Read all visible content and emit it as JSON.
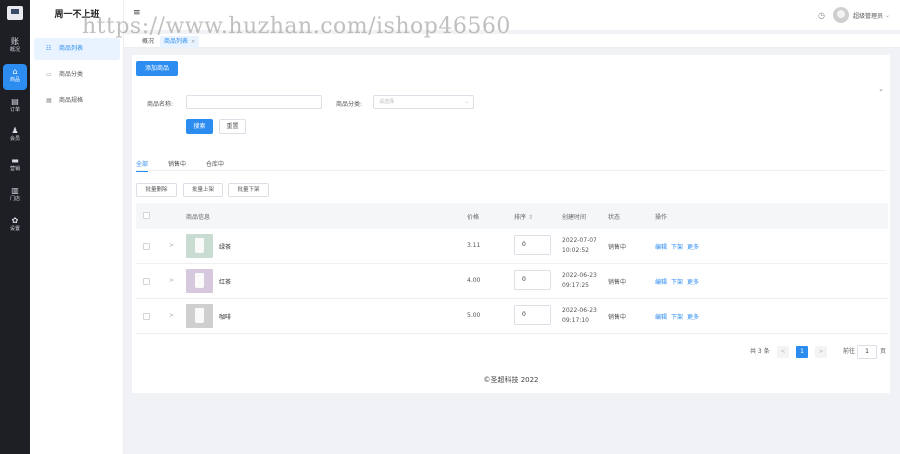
{
  "app": {
    "brand": "周一不上班"
  },
  "rail": [
    {
      "icon": "账",
      "label": "概况"
    },
    {
      "icon": "⌂",
      "label": "商品"
    },
    {
      "icon": "▤",
      "label": "订单"
    },
    {
      "icon": "♟",
      "label": "会员"
    },
    {
      "icon": "▬",
      "label": "营销"
    },
    {
      "icon": "▥",
      "label": "门店"
    },
    {
      "icon": "✿",
      "label": "设置"
    }
  ],
  "submenu": [
    {
      "label": "商品列表"
    },
    {
      "label": "商品分类"
    },
    {
      "label": "商品规格"
    }
  ],
  "header": {
    "menu_icon": "≡",
    "bell_icon": "◷",
    "user_name": "超级管理员",
    "chevron": "⌄"
  },
  "tabs": [
    {
      "label": "概况"
    },
    {
      "label": "商品列表",
      "close": "×"
    }
  ],
  "toolbar": {
    "add_label": "添加商品",
    "collapse_icon": "⌄"
  },
  "filters": {
    "name_label": "商品名称:",
    "name_value": "",
    "category_label": "商品分类:",
    "category_placeholder": "请选择",
    "category_arrow": "⌄",
    "search_label": "搜索",
    "reset_label": "重置"
  },
  "status_tabs": [
    {
      "label": "全部"
    },
    {
      "label": "销售中"
    },
    {
      "label": "仓库中"
    }
  ],
  "batch": {
    "delete": "批量删除",
    "on": "批量上架",
    "off": "批量下架"
  },
  "table": {
    "headers": [
      "商品信息",
      "价格",
      "排序",
      "创建时间",
      "状态",
      "操作"
    ],
    "sort_icon": "⇕",
    "expand_icon": ">",
    "rows": [
      {
        "name": "绿茶",
        "price": "3.11",
        "sort": "0",
        "date": "2022-07-07",
        "time": "10:02:52",
        "status": "销售中",
        "thumb_color": "#c8dcd2",
        "ops": [
          "编辑",
          "下架",
          "更多"
        ]
      },
      {
        "name": "红茶",
        "price": "4.00",
        "sort": "0",
        "date": "2022-06-23",
        "time": "09:17:25",
        "status": "销售中",
        "thumb_color": "#d6c9de",
        "ops": [
          "编辑",
          "下架",
          "更多"
        ]
      },
      {
        "name": "咖啡",
        "price": "5.00",
        "sort": "0",
        "date": "2022-06-23",
        "time": "09:17:10",
        "status": "销售中",
        "thumb_color": "#cfcfcf",
        "ops": [
          "编辑",
          "下架",
          "更多"
        ]
      }
    ]
  },
  "pagination": {
    "total": "共 3 条",
    "prev": "<",
    "current": "1",
    "next": ">",
    "goto_label": "前往",
    "goto_value": "1",
    "page_unit": "页"
  },
  "footer": {
    "copyright": "©圣超科技 2022"
  },
  "watermark": "https://www.huzhan.com/ishop46560",
  "colors": {
    "primary": "#2d8cf0",
    "rail_bg": "#1d1f24"
  }
}
